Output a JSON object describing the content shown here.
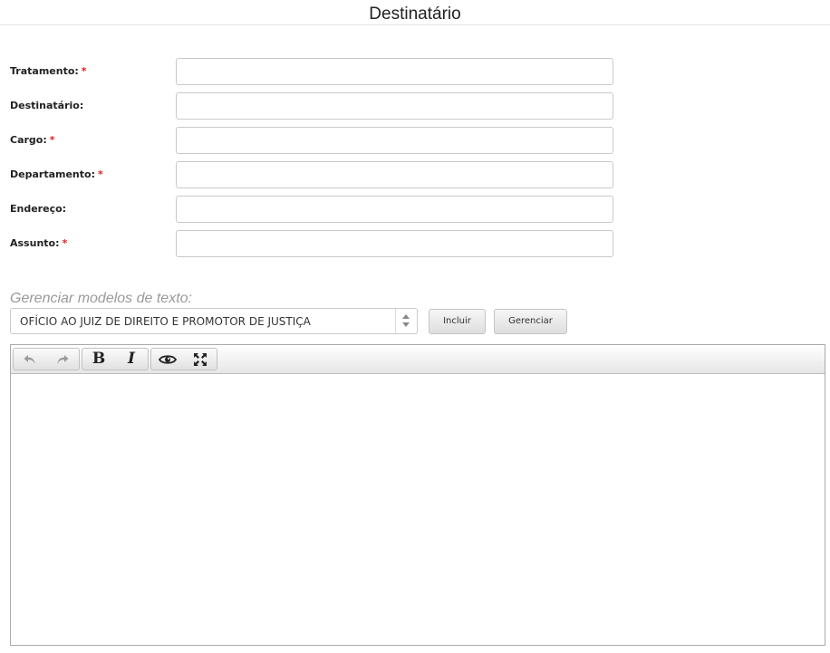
{
  "header": {
    "title": "Destinatário"
  },
  "form": {
    "fields": [
      {
        "label": "Tratamento:",
        "required": true,
        "value": ""
      },
      {
        "label": "Destinatário:",
        "required": false,
        "value": ""
      },
      {
        "label": "Cargo:",
        "required": true,
        "value": ""
      },
      {
        "label": "Departamento:",
        "required": true,
        "value": ""
      },
      {
        "label": "Endereço:",
        "required": false,
        "value": ""
      },
      {
        "label": "Assunto:",
        "required": true,
        "value": ""
      }
    ],
    "required_marker": "*"
  },
  "models": {
    "title": "Gerenciar modelos de texto:",
    "selected": "OFÍCIO AO JUIZ DE DIREITO E PROMOTOR DE JUSTIÇA",
    "include_label": "Incluir",
    "manage_label": "Gerenciar"
  },
  "editor": {
    "toolbar": {
      "undo_icon": "undo-icon",
      "redo_icon": "redo-icon",
      "bold_label": "B",
      "italic_label": "I",
      "preview_icon": "eye-icon",
      "fullscreen_icon": "fullscreen-icon"
    },
    "content": ""
  },
  "colors": {
    "required": "#e02020",
    "muted_title": "#9a9a9a",
    "toolbar_icon_disabled": "#9a9a9a"
  }
}
